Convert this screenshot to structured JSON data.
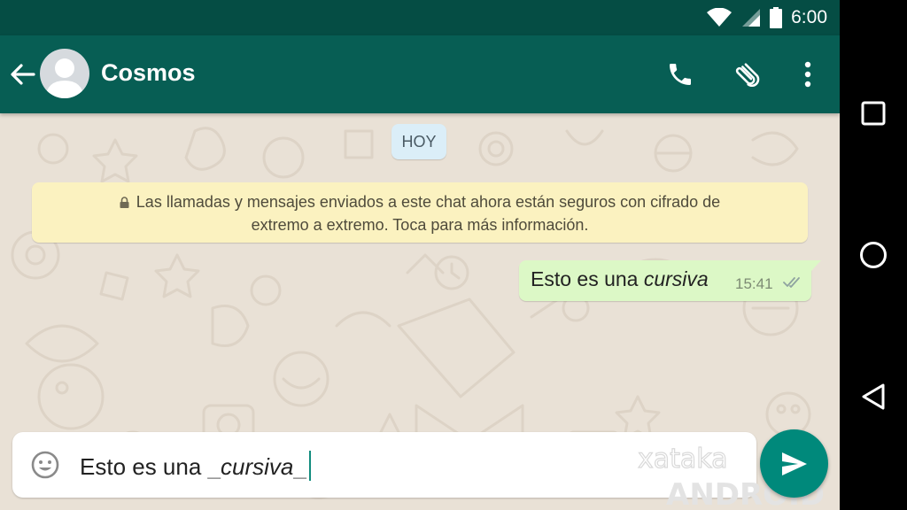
{
  "status_bar": {
    "time": "6:00",
    "icons": [
      "wifi-icon",
      "signal-icon",
      "battery-icon"
    ]
  },
  "header": {
    "title": "Cosmos",
    "icons": [
      "back-arrow-icon",
      "avatar",
      "phone-icon",
      "attach-icon",
      "more-vert-icon"
    ]
  },
  "conversation": {
    "day_label": "HOY",
    "encryption_notice": {
      "line1": "Las llamadas y mensajes enviados a este chat ahora están seguros con cifrado de",
      "line2": "extremo a extremo. Toca para más información."
    },
    "messages": [
      {
        "direction": "outgoing",
        "text_plain": "Esto es una ",
        "text_italic": "cursiva",
        "time": "15:41",
        "status": "read"
      }
    ]
  },
  "composer": {
    "emoji_icon": "emoji-icon",
    "text_plain": "Esto es una ",
    "marker_open": "_",
    "text_italic": "cursiva",
    "marker_close": "_",
    "send_icon": "send-icon"
  },
  "watermark": {
    "brand": "xataka",
    "sub": "ANDROID"
  },
  "nav_bar": {
    "icons": [
      "recents-icon",
      "home-icon",
      "back-icon"
    ]
  },
  "colors": {
    "header": "#075e54",
    "status_bar": "#054d44",
    "bubble_out": "#dcf8c6",
    "notice": "#fbf2c0",
    "day_chip": "#dbeef8",
    "send_button": "#00897b",
    "wallpaper": "#e9e1d6"
  }
}
